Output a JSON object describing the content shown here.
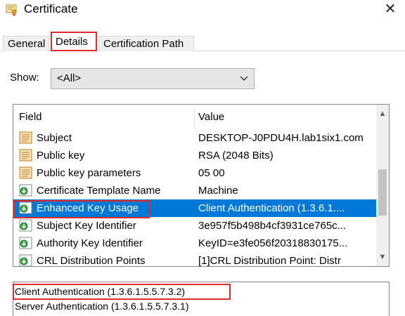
{
  "window": {
    "title": "Certificate",
    "close_glyph": "✕"
  },
  "tabs": [
    {
      "label": "General",
      "selected": false
    },
    {
      "label": "Details",
      "selected": true
    },
    {
      "label": "Certification Path",
      "selected": false
    }
  ],
  "show": {
    "label": "Show:",
    "selected": "<All>"
  },
  "grid": {
    "columns": [
      "Field",
      "Value"
    ],
    "rows": [
      {
        "icon": "certificate-field-icon",
        "field": "Subject",
        "value": "DESKTOP-J0PDU4H.lab1six1.com",
        "selected": false
      },
      {
        "icon": "certificate-field-icon",
        "field": "Public key",
        "value": "RSA (2048 Bits)",
        "selected": false
      },
      {
        "icon": "certificate-field-icon",
        "field": "Public key parameters",
        "value": "05 00",
        "selected": false
      },
      {
        "icon": "extension-icon",
        "field": "Certificate Template Name",
        "value": "Machine",
        "selected": false
      },
      {
        "icon": "extension-icon",
        "field": "Enhanced Key Usage",
        "value": "Client Authentication (1.3.6.1....",
        "selected": true
      },
      {
        "icon": "extension-icon",
        "field": "Subject Key Identifier",
        "value": "3e957f5b498b4cf3931ce765c...",
        "selected": false
      },
      {
        "icon": "extension-icon",
        "field": "Authority Key Identifier",
        "value": "KeyID=e3fe056f20318830175...",
        "selected": false
      },
      {
        "icon": "extension-icon",
        "field": "CRL Distribution Points",
        "value": "[1]CRL Distribution Point: Distr",
        "selected": false
      }
    ],
    "scroll_up_glyph": "▲",
    "scroll_down_glyph": "▼"
  },
  "detail": {
    "lines": [
      "Client Authentication (1.3.6.1.5.5.7.3.2)",
      "Server Authentication (1.3.6.1.5.5.7.3.1)"
    ]
  },
  "colors": {
    "selection": "#0078d7",
    "highlight_outline": "#e32a2a"
  }
}
